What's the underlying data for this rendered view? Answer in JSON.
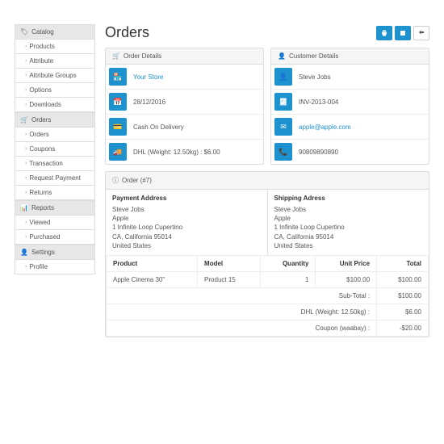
{
  "page_title": "Orders",
  "sidebar": {
    "groups": [
      {
        "icon": "tag",
        "label": "Catalog",
        "items": [
          "Products",
          "Attribute",
          "Attribute Groups",
          "Options",
          "Downloads"
        ]
      },
      {
        "icon": "cart",
        "label": "Orders",
        "items": [
          "Orders",
          "Coupons",
          "Transaction",
          "Request Payment",
          "Returns"
        ]
      },
      {
        "icon": "chart",
        "label": "Reports",
        "items": [
          "Viewed",
          "Purchased"
        ]
      },
      {
        "icon": "user",
        "label": "Settings",
        "items": [
          "Profile"
        ]
      }
    ]
  },
  "order_details": {
    "title": "Order Details",
    "store": "Your Store",
    "date": "28/12/2016",
    "payment": "Cash On Delivery",
    "shipping": "DHL (Weight: 12.50kg) : $6.00"
  },
  "customer_details": {
    "title": "Customer Details",
    "name": "Steve Jobs",
    "invoice": "INV-2013-004",
    "email": "apple@apple.com",
    "phone": "90809890890"
  },
  "order_panel": {
    "title": "Order (#7)"
  },
  "payment_address": {
    "head": "Payment Address",
    "lines": [
      "Steve Jobs",
      "Apple",
      "1 Infinite Loop Cupertino",
      "CA, California 95014",
      "United States"
    ]
  },
  "shipping_address": {
    "head": "Shipping Adress",
    "lines": [
      "Steve Jobs",
      "Apple",
      "1 Infinite Loop Cupertino",
      "CA, California 95014",
      "United States"
    ]
  },
  "table": {
    "headers": {
      "product": "Product",
      "model": "Model",
      "qty": "Quantity",
      "unit": "Unit Price",
      "total": "Total"
    },
    "rows": [
      {
        "product": "Apple Cinema 30\"",
        "model": "Product 15",
        "qty": "1",
        "unit": "$100.00",
        "total": "$100.00"
      }
    ],
    "totals": [
      {
        "label": "Sub-Total :",
        "value": "$100.00"
      },
      {
        "label": "DHL (Weight: 12.50kg) :",
        "value": "$6.00"
      },
      {
        "label": "Coupon (waabay) :",
        "value": "-$20.00"
      }
    ]
  }
}
